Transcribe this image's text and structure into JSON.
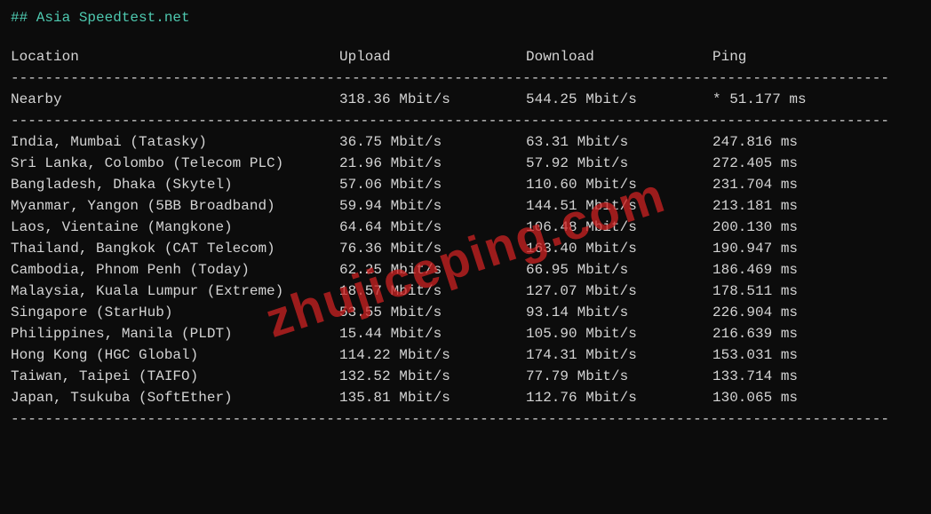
{
  "title": "## Asia Speedtest.net",
  "headers": {
    "location": "Location",
    "upload": "Upload",
    "download": "Download",
    "ping": "Ping"
  },
  "nearby": {
    "location": "Nearby",
    "upload": "318.36 Mbit/s",
    "download": "544.25 Mbit/s",
    "ping": "* 51.177 ms"
  },
  "rows": [
    {
      "location": "India, Mumbai (Tatasky)",
      "upload": "36.75 Mbit/s",
      "download": "63.31 Mbit/s",
      "ping": "247.816 ms"
    },
    {
      "location": "Sri Lanka, Colombo (Telecom PLC)",
      "upload": "21.96 Mbit/s",
      "download": "57.92 Mbit/s",
      "ping": "272.405 ms"
    },
    {
      "location": "Bangladesh, Dhaka (Skytel)",
      "upload": "57.06 Mbit/s",
      "download": "110.60 Mbit/s",
      "ping": "231.704 ms"
    },
    {
      "location": "Myanmar, Yangon (5BB Broadband)",
      "upload": "59.94 Mbit/s",
      "download": "144.51 Mbit/s",
      "ping": "213.181 ms"
    },
    {
      "location": "Laos, Vientaine (Mangkone)",
      "upload": "64.64 Mbit/s",
      "download": "106.48 Mbit/s",
      "ping": "200.130 ms"
    },
    {
      "location": "Thailand, Bangkok (CAT Telecom)",
      "upload": "76.36 Mbit/s",
      "download": "163.40 Mbit/s",
      "ping": "190.947 ms"
    },
    {
      "location": "Cambodia, Phnom Penh (Today)",
      "upload": "62.25 Mbit/s",
      "download": "66.95 Mbit/s",
      "ping": "186.469 ms"
    },
    {
      "location": "Malaysia, Kuala Lumpur (Extreme)",
      "upload": "18.57 Mbit/s",
      "download": "127.07 Mbit/s",
      "ping": "178.511 ms"
    },
    {
      "location": "Singapore (StarHub)",
      "upload": "53.55 Mbit/s",
      "download": "93.14 Mbit/s",
      "ping": "226.904 ms"
    },
    {
      "location": "Philippines, Manila (PLDT)",
      "upload": "15.44 Mbit/s",
      "download": "105.90 Mbit/s",
      "ping": "216.639 ms"
    },
    {
      "location": "Hong Kong (HGC Global)",
      "upload": "114.22 Mbit/s",
      "download": "174.31 Mbit/s",
      "ping": "153.031 ms"
    },
    {
      "location": "Taiwan, Taipei (TAIFO)",
      "upload": "132.52 Mbit/s",
      "download": "77.79 Mbit/s",
      "ping": "133.714 ms"
    },
    {
      "location": "Japan, Tsukuba (SoftEther)",
      "upload": "135.81 Mbit/s",
      "download": "112.76 Mbit/s",
      "ping": "130.065 ms"
    }
  ],
  "watermark": "zhujiceping.com",
  "divider": "-------------------------------------------------------------------------------------------------------"
}
